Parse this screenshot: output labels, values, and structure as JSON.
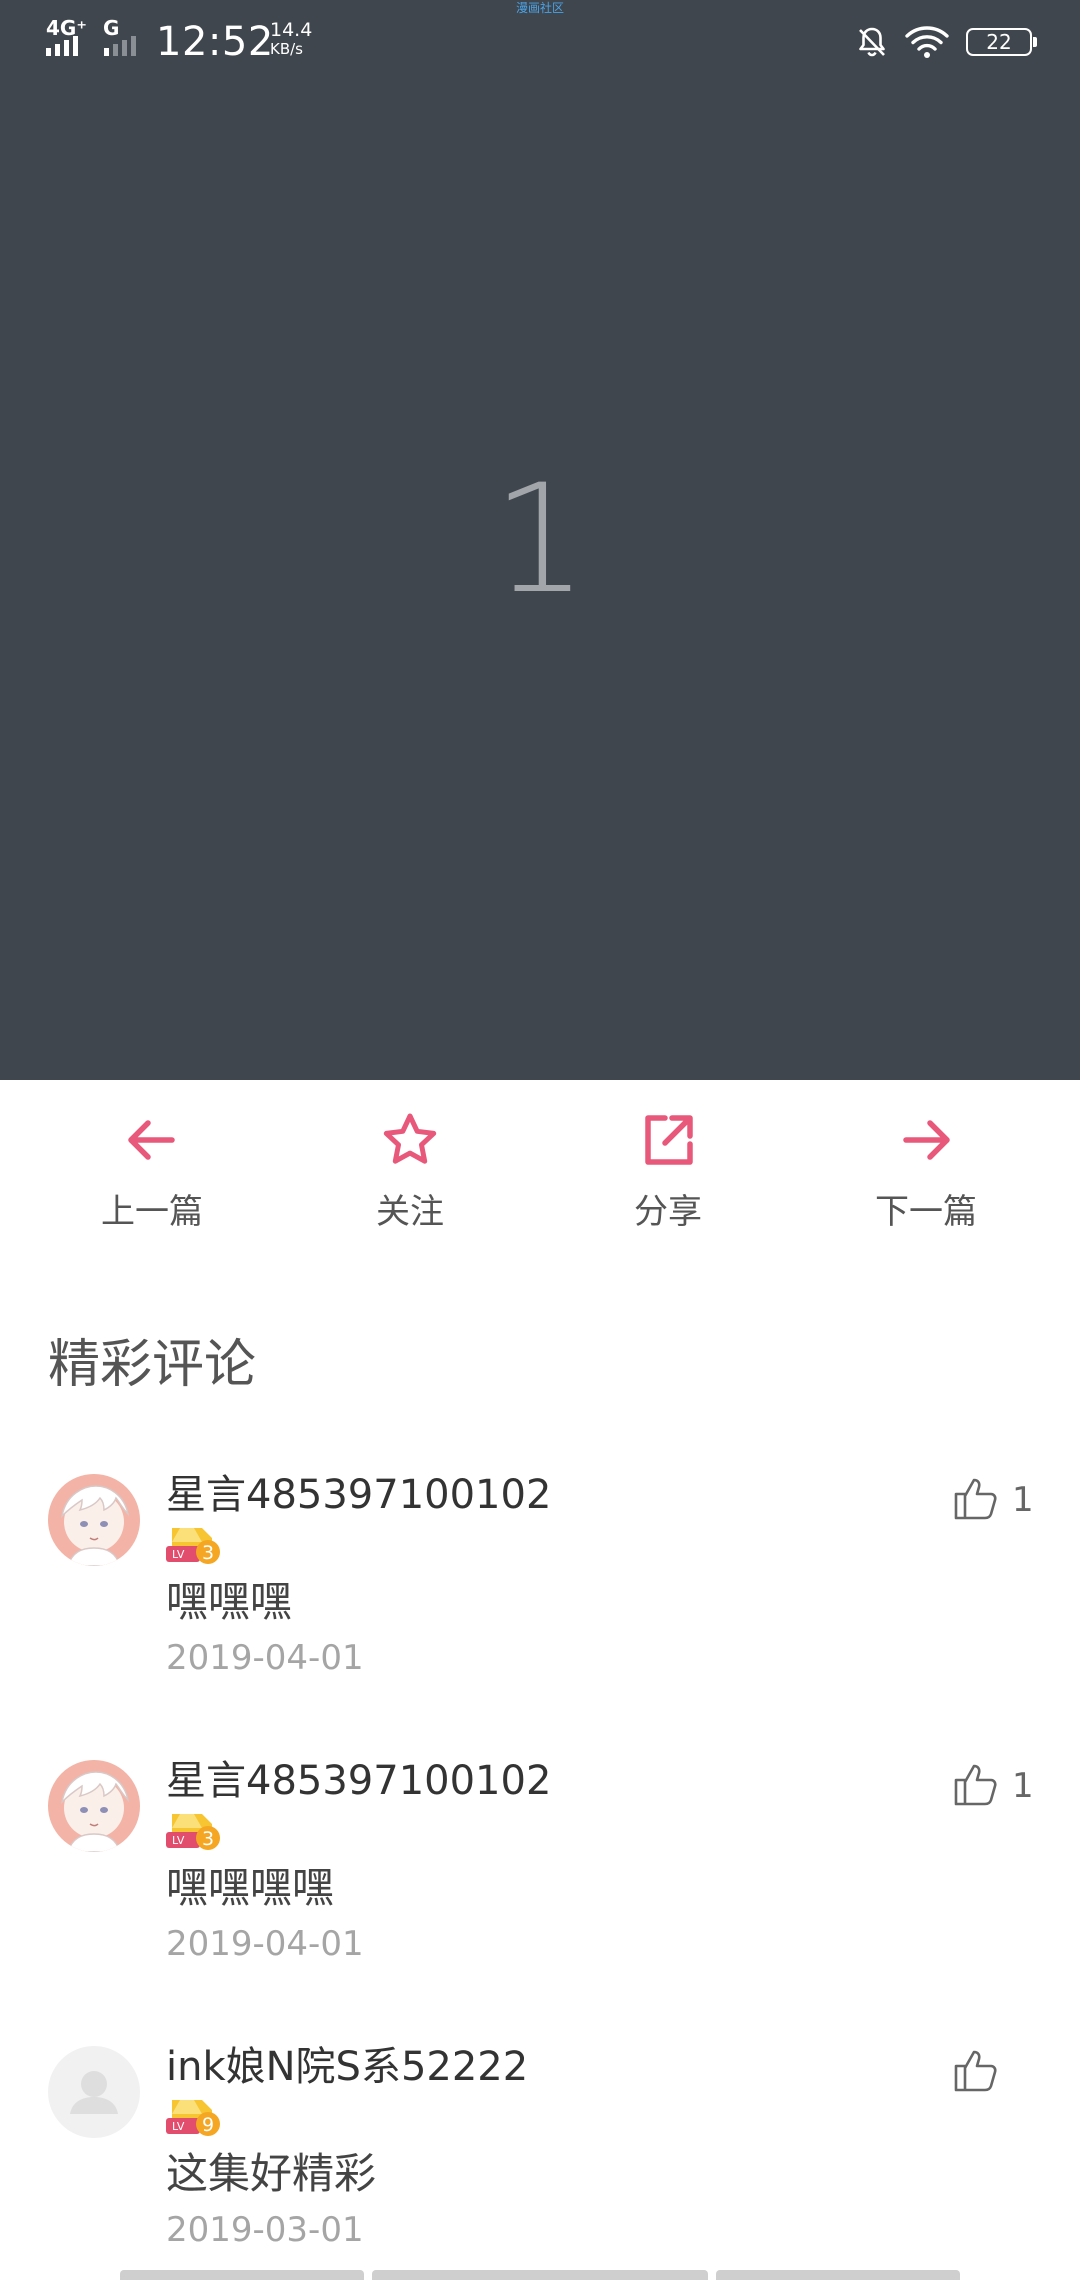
{
  "status_bar": {
    "network_1": "4G⁺",
    "network_2": "G",
    "time": "12:52",
    "speed_value": "14.4",
    "speed_unit": "KB/s",
    "app_label": "漫画社区",
    "battery": "22",
    "icons": [
      "signal-icon",
      "mute-bell-icon",
      "wifi-icon",
      "battery-icon"
    ]
  },
  "hero": {
    "number": "1"
  },
  "actions": {
    "prev_label": "上一篇",
    "follow_label": "关注",
    "share_label": "分享",
    "next_label": "下一篇",
    "accent_color": "#e8587a"
  },
  "comments_section": {
    "title": "精彩评论",
    "items": [
      {
        "name": "星言485397100102",
        "level": "3",
        "level_prefix": "LV",
        "text": "嘿嘿嘿",
        "date": "2019-04-01",
        "likes": "1",
        "avatar": "anime-avatar"
      },
      {
        "name": "星言485397100102",
        "level": "3",
        "level_prefix": "LV",
        "text": "嘿嘿嘿嘿",
        "date": "2019-04-01",
        "likes": "1",
        "avatar": "anime-avatar"
      },
      {
        "name": "ink娘N院S系52222",
        "level": "9",
        "level_prefix": "LV",
        "text": "这集好精彩",
        "date": "2019-03-01",
        "likes": "",
        "avatar": "default-avatar"
      }
    ]
  }
}
